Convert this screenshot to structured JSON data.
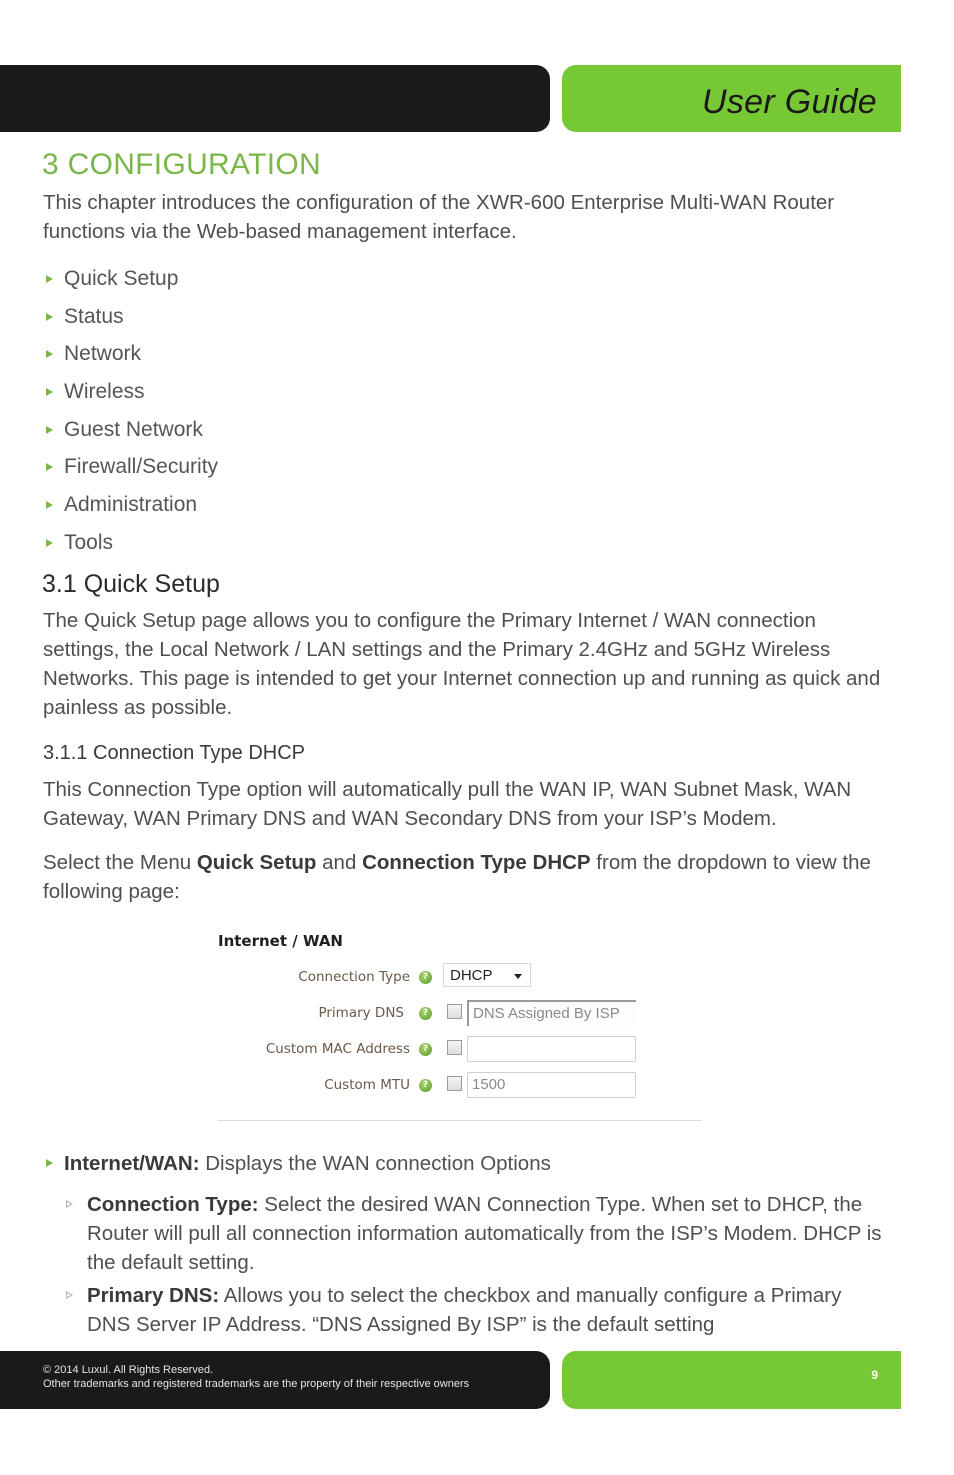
{
  "header": {
    "title": "User Guide"
  },
  "chapter": {
    "heading": "3 CONFIGURATION",
    "intro": "This chapter introduces the configuration of the XWR-600 Enterprise Multi-WAN Router functions via the Web-based management interface.",
    "toc": [
      "Quick Setup",
      "Status",
      "Network",
      "Wireless",
      "Guest Network",
      "Firewall/Security",
      "Administration",
      "Tools"
    ]
  },
  "section_3_1": {
    "heading": "3.1 Quick Setup",
    "body": "The Quick Setup page allows you to configure the Primary Internet / WAN connection settings, the Local Network / LAN settings and the Primary 2.4GHz and 5GHz Wireless Networks. This page is intended to get your Internet connection up and running as quick and painless as possible."
  },
  "section_3_1_1": {
    "heading": "3.1.1 Connection Type DHCP",
    "body": "This Connection Type option will automatically pull the WAN IP, WAN Subnet Mask, WAN Gateway, WAN Primary DNS and WAN Secondary DNS from your ISP’s Modem.",
    "select_prefix": "Select the Menu ",
    "select_bold1": "Quick Setup",
    "select_mid": " and ",
    "select_bold2": "Connection Type DHCP",
    "select_suffix": " from the dropdown to view the following page:"
  },
  "screenshot": {
    "title": "Internet / WAN",
    "rows": [
      {
        "label": "Connection Type",
        "type": "select",
        "value": "DHCP"
      },
      {
        "label": "Primary DNS",
        "type": "checkbox-input",
        "checked": false,
        "value": "DNS Assigned By ISP"
      },
      {
        "label": "Custom MAC Address",
        "type": "checkbox-input",
        "checked": false,
        "value": ""
      },
      {
        "label": "Custom MTU",
        "type": "checkbox-input",
        "checked": false,
        "value": "1500"
      }
    ],
    "help_icon": "?"
  },
  "bullets": {
    "main": {
      "bold": "Internet/WAN:",
      "text": " Displays the WAN connection Options"
    },
    "subs": [
      {
        "bold": "Connection Type:",
        "text": " Select the desired WAN Connection Type. When set to DHCP, the Router will pull all connection information automatically from the ISP’s Modem. DHCP is the default setting."
      },
      {
        "bold": "Primary DNS:",
        "text": " Allows you to select the checkbox and manually configure a Primary DNS Server IP Address. “DNS Assigned By ISP” is the default setting"
      }
    ]
  },
  "footer": {
    "copyright": "© 2014  Luxul. All Rights Reserved.",
    "trademark": "Other trademarks and registered trademarks are the property of their respective owners",
    "page_number": "9"
  },
  "colors": {
    "brand_green": "#76c935",
    "heading_green": "#7ab648",
    "dark": "#1b191b"
  }
}
